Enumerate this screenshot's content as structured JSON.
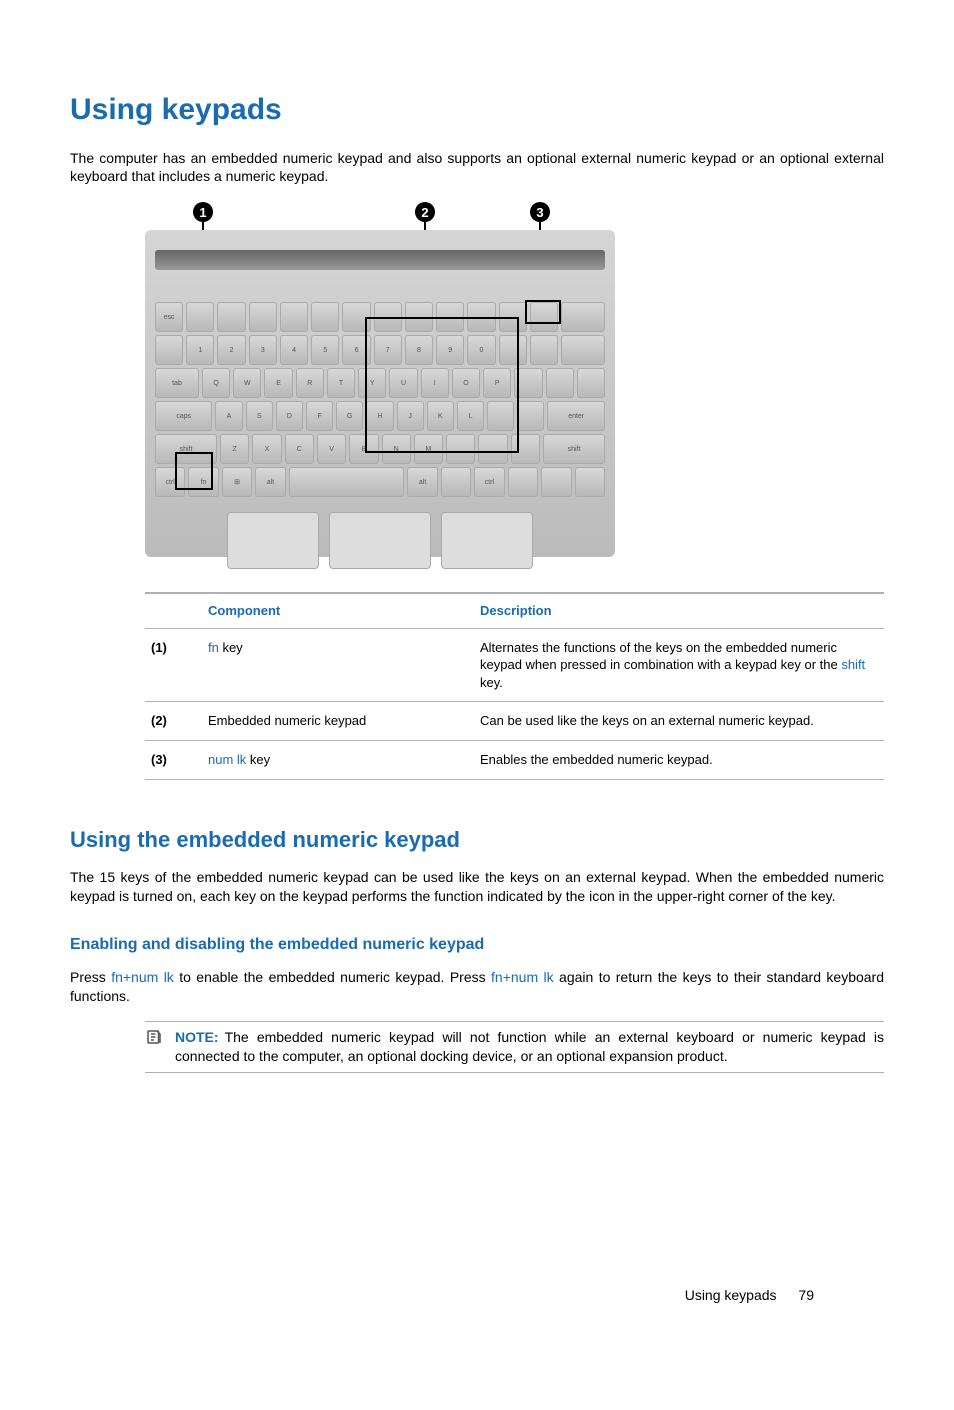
{
  "headings": {
    "h1": "Using keypads",
    "h2": "Using the embedded numeric keypad",
    "h3": "Enabling and disabling the embedded numeric keypad"
  },
  "intro": "The computer has an embedded numeric keypad and also supports an optional external numeric keypad or an optional external keyboard that includes a numeric keypad.",
  "callouts": {
    "c1": "1",
    "c2": "2",
    "c3": "3"
  },
  "table": {
    "header": {
      "component": "Component",
      "description": "Description"
    },
    "rows": [
      {
        "num": "(1)",
        "component_link": "fn",
        "component_rest": " key",
        "desc_before": "Alternates the functions of the keys on the embedded numeric keypad when pressed in combination with a keypad key or the ",
        "desc_link": "shift",
        "desc_after": " key."
      },
      {
        "num": "(2)",
        "component_plain": "Embedded numeric keypad",
        "desc_plain": "Can be used like the keys on an external numeric keypad."
      },
      {
        "num": "(3)",
        "component_link": "num lk",
        "component_rest": " key",
        "desc_plain": "Enables the embedded numeric keypad."
      }
    ]
  },
  "para_embedded": "The 15 keys of the embedded numeric keypad can be used like the keys on an external keypad. When the embedded numeric keypad is turned on, each key on the keypad performs the function indicated by the icon in the upper-right corner of the key.",
  "para_enable": {
    "t1": "Press ",
    "k1": "fn+num lk",
    "t2": " to enable the embedded numeric keypad. Press ",
    "k2": "fn+num lk",
    "t3": " again to return the keys to their standard keyboard functions."
  },
  "note": {
    "label": "NOTE:",
    "text": "The embedded numeric keypad will not function while an external keyboard or numeric keypad is connected to the computer, an optional docking device, or an optional expansion product."
  },
  "footer": {
    "title": "Using keypads",
    "page": "79"
  }
}
